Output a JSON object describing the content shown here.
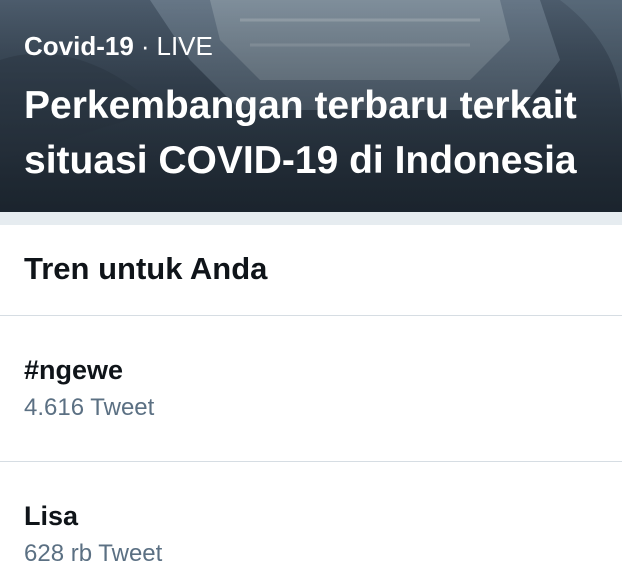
{
  "hero": {
    "category": "Covid-19",
    "separator": "·",
    "live": "LIVE",
    "title_line1": "Perkembangan terbaru terkait",
    "title_line2": "situasi COVID-19 di Indonesia"
  },
  "section": {
    "title": "Tren untuk Anda"
  },
  "trends": [
    {
      "name": "#ngewe",
      "count": "4.616 Tweet"
    },
    {
      "name": "Lisa",
      "count": "628 rb Tweet"
    }
  ],
  "colors": {
    "text_primary": "#0f1419",
    "text_secondary": "#5b7083",
    "divider": "#e6ecf0"
  }
}
